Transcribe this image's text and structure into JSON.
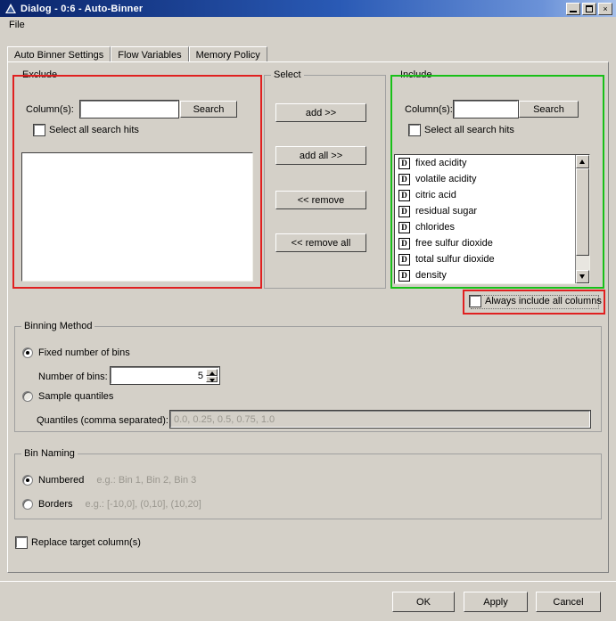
{
  "window": {
    "title": "Dialog - 0:6 - Auto-Binner",
    "icon": "knime-triangle-icon",
    "controls": {
      "minimize": "minimize-icon",
      "maximize": "maximize-icon",
      "close": "×"
    }
  },
  "menubar": {
    "items": [
      {
        "label": "File"
      }
    ]
  },
  "tabs": [
    {
      "label": "Auto Binner Settings",
      "active": true
    },
    {
      "label": "Flow Variables",
      "active": false
    },
    {
      "label": "Memory Policy",
      "active": false
    }
  ],
  "exclude": {
    "legend": "Exclude",
    "column_label": "Column(s):",
    "search_value": "",
    "search_button": "Search",
    "select_all_hits_label": "Select all search hits",
    "select_all_hits_checked": false,
    "items": []
  },
  "select": {
    "legend": "Select",
    "buttons": [
      {
        "label": "add >>"
      },
      {
        "label": "add all >>"
      },
      {
        "label": "<< remove"
      },
      {
        "label": "<< remove all"
      }
    ]
  },
  "include": {
    "legend": "Include",
    "column_label": "Column(s):",
    "search_value": "",
    "search_button": "Search",
    "select_all_hits_label": "Select all search hits",
    "select_all_hits_checked": false,
    "items": [
      {
        "type": "D",
        "label": "fixed acidity"
      },
      {
        "type": "D",
        "label": "volatile acidity"
      },
      {
        "type": "D",
        "label": "citric acid"
      },
      {
        "type": "D",
        "label": "residual sugar"
      },
      {
        "type": "D",
        "label": "chlorides"
      },
      {
        "type": "D",
        "label": "free sulfur dioxide"
      },
      {
        "type": "D",
        "label": "total sulfur dioxide"
      },
      {
        "type": "D",
        "label": "density"
      }
    ]
  },
  "always_include": {
    "label": "Always include all columns",
    "checked": false
  },
  "binning_method": {
    "legend": "Binning Method",
    "fixed_bins": {
      "label": "Fixed number of bins",
      "selected": true,
      "number_label": "Number of bins:",
      "number_value": "5"
    },
    "sample_quantiles": {
      "label": "Sample quantiles",
      "selected": false,
      "quantiles_label": "Quantiles (comma separated):",
      "quantiles_placeholder": "0.0, 0.25, 0.5, 0.75, 1.0",
      "quantiles_value": ""
    }
  },
  "bin_naming": {
    "legend": "Bin Naming",
    "options": [
      {
        "label": "Numbered",
        "example": "e.g.: Bin 1, Bin 2, Bin 3",
        "selected": true
      },
      {
        "label": "Borders",
        "example": "e.g.: [-10,0], (0,10], (10,20]",
        "selected": false
      }
    ]
  },
  "replace_target": {
    "label": "Replace target column(s)",
    "checked": false
  },
  "footer": {
    "buttons": [
      {
        "label": "OK"
      },
      {
        "label": "Apply"
      },
      {
        "label": "Cancel"
      }
    ]
  },
  "annotations": {
    "exclude_highlight_color": "#e02020",
    "include_highlight_color": "#18c018",
    "always_include_highlight_color": "#e02020"
  }
}
